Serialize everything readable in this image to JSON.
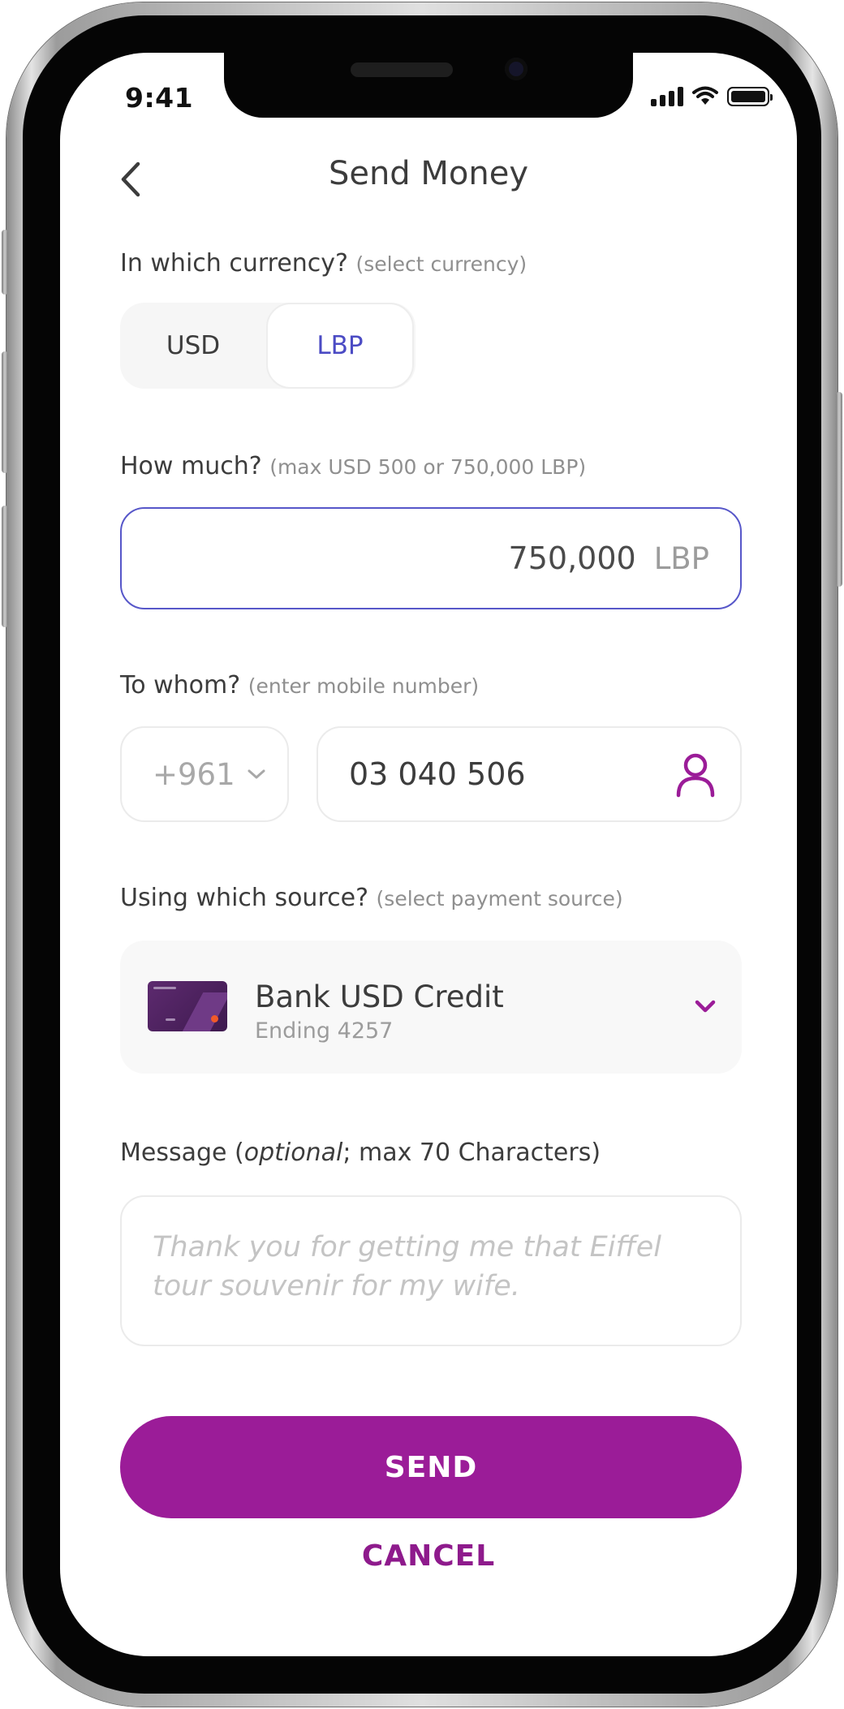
{
  "status_bar": {
    "time": "9:41"
  },
  "header": {
    "title": "Send Money"
  },
  "currency": {
    "question": "In which currency?",
    "hint": "(select currency)",
    "options": [
      "USD",
      "LBP"
    ],
    "selected": "LBP"
  },
  "amount": {
    "question": "How much?",
    "hint": "(max USD 500 or 750,000 LBP)",
    "value": "750,000",
    "unit": "LBP"
  },
  "recipient": {
    "question": "To whom?",
    "hint": "(enter mobile number)",
    "country_code": "+961",
    "phone_number": "03 040 506"
  },
  "source": {
    "question": "Using which source?",
    "hint": "(select payment source)",
    "name": "Bank USD Credit",
    "subtitle": "Ending 4257"
  },
  "message": {
    "label_prefix": "Message (",
    "label_italic": "optional",
    "label_suffix": "; max 70 Characters)",
    "placeholder": "Thank you for getting me that Eiffel tour souvenir for my wife."
  },
  "actions": {
    "send_label": "SEND",
    "cancel_label": "CANCEL"
  },
  "colors": {
    "accent": "#9b1c98",
    "selected": "#4b4bc4",
    "focus_border": "#5757c9"
  },
  "icons": [
    "back-chevron-icon",
    "signal-icon",
    "wifi-icon",
    "battery-icon",
    "chevron-down-icon",
    "contact-person-icon",
    "credit-card-icon"
  ]
}
